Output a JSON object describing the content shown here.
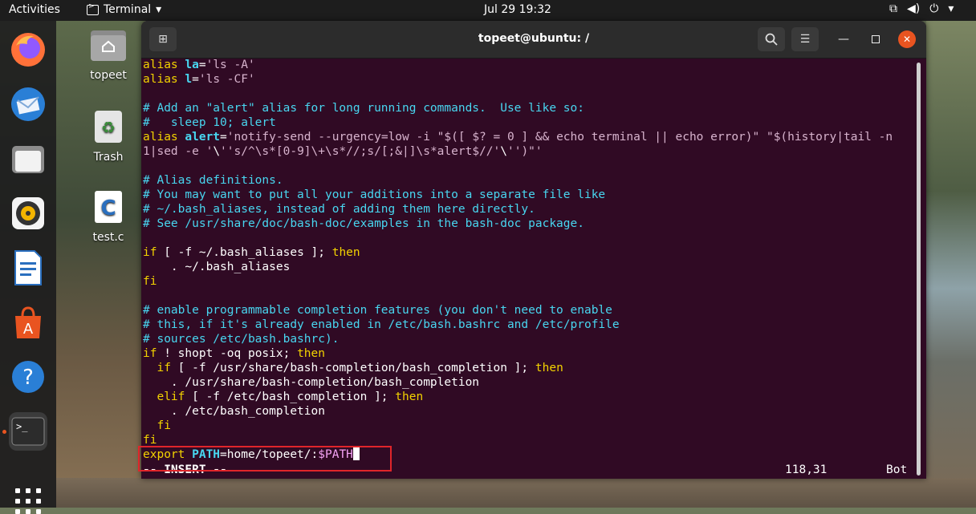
{
  "topbar": {
    "activities": "Activities",
    "app_name": "Terminal",
    "clock": "Jul 29  19:32"
  },
  "desktop": {
    "icons": [
      {
        "label": "topeet"
      },
      {
        "label": "Trash"
      },
      {
        "label": "test.c"
      }
    ]
  },
  "window": {
    "title": "topeet@ubuntu: /"
  },
  "editor": {
    "lines": [
      {
        "parts": [
          [
            "k",
            "alias "
          ],
          [
            "kb",
            "la"
          ],
          [
            "w",
            "="
          ],
          [
            "s",
            "'ls -A'"
          ]
        ]
      },
      {
        "parts": [
          [
            "k",
            "alias "
          ],
          [
            "kb",
            "l"
          ],
          [
            "w",
            "="
          ],
          [
            "s",
            "'ls -CF'"
          ]
        ]
      },
      {
        "parts": []
      },
      {
        "parts": [
          [
            "c",
            "# Add an \"alert\" alias for long running commands.  Use like so:"
          ]
        ]
      },
      {
        "parts": [
          [
            "c",
            "#   sleep 10; alert"
          ]
        ]
      },
      {
        "parts": [
          [
            "k",
            "alias "
          ],
          [
            "kb",
            "alert"
          ],
          [
            "w",
            "="
          ],
          [
            "s",
            "'notify-send --urgency=low -i \"$([ $? = 0 ] && echo terminal || echo error)\" \"$(history|tail -n"
          ]
        ]
      },
      {
        "parts": [
          [
            "s",
            "1|sed -e '"
          ],
          [
            "w",
            "\\"
          ],
          [
            "s",
            "''s/^\\s*[0-9]\\+\\s*//;s/[;&|]\\s*alert$//'"
          ],
          [
            "w",
            "\\"
          ],
          [
            "s",
            "'')\"'"
          ]
        ]
      },
      {
        "parts": []
      },
      {
        "parts": [
          [
            "c",
            "# Alias definitions."
          ]
        ]
      },
      {
        "parts": [
          [
            "c",
            "# You may want to put all your additions into a separate file like"
          ]
        ]
      },
      {
        "parts": [
          [
            "c",
            "# ~/.bash_aliases, instead of adding them here directly."
          ]
        ]
      },
      {
        "parts": [
          [
            "c",
            "# See /usr/share/doc/bash-doc/examples in the bash-doc package."
          ]
        ]
      },
      {
        "parts": []
      },
      {
        "parts": [
          [
            "k",
            "if "
          ],
          [
            "w",
            "[ -f ~/.bash_aliases ]; "
          ],
          [
            "k",
            "then"
          ]
        ]
      },
      {
        "parts": [
          [
            "w",
            "    . ~/.bash_aliases"
          ]
        ]
      },
      {
        "parts": [
          [
            "k",
            "fi"
          ]
        ]
      },
      {
        "parts": []
      },
      {
        "parts": [
          [
            "c",
            "# enable programmable completion features (you don't need to enable"
          ]
        ]
      },
      {
        "parts": [
          [
            "c",
            "# this, if it's already enabled in /etc/bash.bashrc and /etc/profile"
          ]
        ]
      },
      {
        "parts": [
          [
            "c",
            "# sources /etc/bash.bashrc)."
          ]
        ]
      },
      {
        "parts": [
          [
            "k",
            "if "
          ],
          [
            "w",
            "! shopt -oq posix; "
          ],
          [
            "k",
            "then"
          ]
        ]
      },
      {
        "parts": [
          [
            "k",
            "  if "
          ],
          [
            "w",
            "[ -f /usr/share/bash-completion/bash_completion ]; "
          ],
          [
            "k",
            "then"
          ]
        ]
      },
      {
        "parts": [
          [
            "w",
            "    . /usr/share/bash-completion/bash_completion"
          ]
        ]
      },
      {
        "parts": [
          [
            "k",
            "  elif "
          ],
          [
            "w",
            "[ -f /etc/bash_completion ]; "
          ],
          [
            "k",
            "then"
          ]
        ]
      },
      {
        "parts": [
          [
            "w",
            "    . /etc/bash_completion"
          ]
        ]
      },
      {
        "parts": [
          [
            "k",
            "  fi"
          ]
        ]
      },
      {
        "parts": [
          [
            "k",
            "fi"
          ]
        ]
      },
      {
        "parts": [
          [
            "k",
            "export "
          ],
          [
            "kb",
            "PATH"
          ],
          [
            "w",
            "=home/topeet/:"
          ],
          [
            "v",
            "$PATH"
          ]
        ]
      }
    ],
    "status": {
      "mode": "-- INSERT --",
      "position": "118,31",
      "scroll": "Bot"
    }
  }
}
